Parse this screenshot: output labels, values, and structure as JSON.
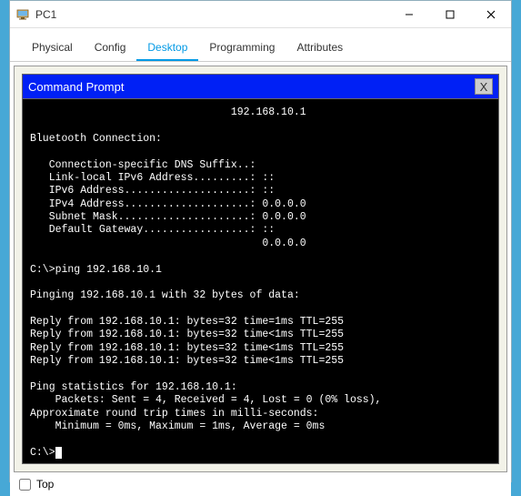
{
  "window": {
    "title": "PC1"
  },
  "tabs": {
    "items": [
      {
        "label": "Physical"
      },
      {
        "label": "Config"
      },
      {
        "label": "Desktop"
      },
      {
        "label": "Programming"
      },
      {
        "label": "Attributes"
      }
    ],
    "active_index": 2
  },
  "prompt": {
    "title": "Command Prompt",
    "close": "X"
  },
  "terminal": {
    "lines": "                                192.168.10.1\n\nBluetooth Connection:\n\n   Connection-specific DNS Suffix..:\n   Link-local IPv6 Address.........: ::\n   IPv6 Address....................: ::\n   IPv4 Address....................: 0.0.0.0\n   Subnet Mask.....................: 0.0.0.0\n   Default Gateway.................: ::\n                                     0.0.0.0\n\nC:\\>ping 192.168.10.1\n\nPinging 192.168.10.1 with 32 bytes of data:\n\nReply from 192.168.10.1: bytes=32 time=1ms TTL=255\nReply from 192.168.10.1: bytes=32 time<1ms TTL=255\nReply from 192.168.10.1: bytes=32 time<1ms TTL=255\nReply from 192.168.10.1: bytes=32 time<1ms TTL=255\n\nPing statistics for 192.168.10.1:\n    Packets: Sent = 4, Received = 4, Lost = 0 (0% loss),\nApproximate round trip times in milli-seconds:\n    Minimum = 0ms, Maximum = 1ms, Average = 0ms\n\nC:\\>"
  },
  "bottom": {
    "top_label": "Top"
  }
}
